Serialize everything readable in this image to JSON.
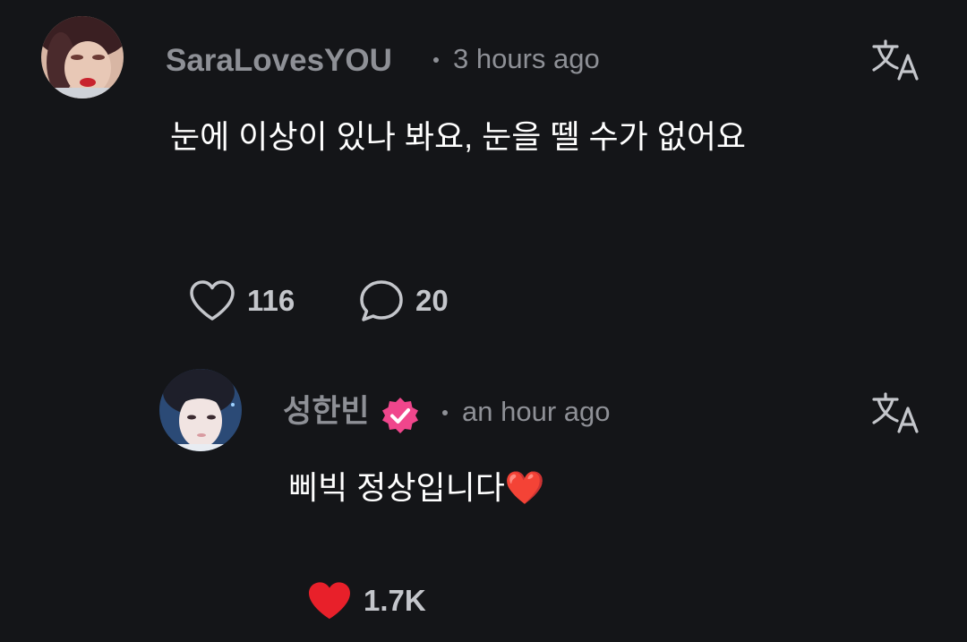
{
  "comments": [
    {
      "username": "SaraLovesYOU",
      "time": "3 hours ago",
      "text": "눈에 이상이 있나 봐요, 눈을 뗄 수가 없어요",
      "likes": "116",
      "replies": "20",
      "liked": false,
      "avatar": "user-photo-avatar"
    },
    {
      "username": "성한빈",
      "verified": true,
      "time": "an hour ago",
      "text": "삐빅 정상입니다❤️",
      "likes": "1.7K",
      "liked": true,
      "avatar": "artist-photo-avatar"
    }
  ],
  "icons": {
    "translate": "translate-icon",
    "like": "heart-icon",
    "reply": "comment-bubble-icon",
    "verified": "verified-badge-icon"
  },
  "colors": {
    "background": "#141518",
    "meta_text": "#8e9096",
    "liked_heart": "#e8202a",
    "verified_badge": "#f0468c"
  }
}
